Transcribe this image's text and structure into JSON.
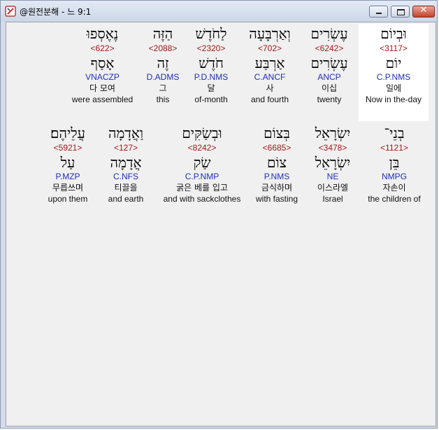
{
  "window": {
    "title": "@원전분해 - 느 9:1",
    "buttons": {
      "minimize": "minimize",
      "maximize": "maximize",
      "close": "✕"
    }
  },
  "rows": [
    {
      "words": [
        {
          "heb1": "וּבְיוֹם",
          "num": "<3117>",
          "heb2": "יוֹם",
          "gram": "C.P.NMS",
          "kor": "일에",
          "eng": "Now in the-day"
        },
        {
          "heb1": "עֶשְׂרִים",
          "num": "<6242>",
          "heb2": "עֶשְׂרִים",
          "gram": "ANCP",
          "kor": "이십",
          "eng": "twenty"
        },
        {
          "heb1": "וְאַרְבָּעָה",
          "num": "<702>",
          "heb2": "אַרְבַּע",
          "gram": "C.ANCF",
          "kor": "사",
          "eng": "and fourth"
        },
        {
          "heb1": "לַחֹדֶשׁ",
          "num": "<2320>",
          "heb2": "חֹדֶשׁ",
          "gram": "P.D.NMS",
          "kor": "달",
          "eng": "of-month"
        },
        {
          "heb1": "הַזֶּה",
          "num": "<2088>",
          "heb2": "זֶה",
          "gram": "D.ADMS",
          "kor": "그",
          "eng": "this"
        },
        {
          "heb1": "נֶאֶסְפוּ",
          "num": "<622>",
          "heb2": "אָסַף",
          "gram": "VNACZP",
          "kor": "다 모여",
          "eng": "were assembled"
        }
      ]
    },
    {
      "words": [
        {
          "heb1": "בְנֵי־",
          "num": "<1121>",
          "heb2": "בֵּן",
          "gram": "NMPG",
          "kor": "자손이",
          "eng": "the children of"
        },
        {
          "heb1": "יִשְׂרָאֵל",
          "num": "<3478>",
          "heb2": "יִשְׂרָאֵל",
          "gram": "NE",
          "kor": "이스라엘",
          "eng": "Israel"
        },
        {
          "heb1": "בְּצוֹם",
          "num": "<6685>",
          "heb2": "צוֹם",
          "gram": "P.NMS",
          "kor": "금식하며",
          "eng": "with fasting"
        },
        {
          "heb1": "וּבְשַׂקִּים",
          "num": "<8242>",
          "heb2": "שַׂק",
          "gram": "C.P.NMP",
          "kor": "굵은 베를 입고",
          "eng": "and with sackclothes"
        },
        {
          "heb1": "וַאֲדָמָה",
          "num": "<127>",
          "heb2": "אֲדָמָה",
          "gram": "C.NFS",
          "kor": "티끌을",
          "eng": "and earth"
        },
        {
          "heb1": "עֲלֵיהֶם׃",
          "num": "<5921>",
          "heb2": "עַל",
          "gram": "P.MZP",
          "kor": "무릅쓰며",
          "eng": "upon them"
        }
      ]
    }
  ]
}
